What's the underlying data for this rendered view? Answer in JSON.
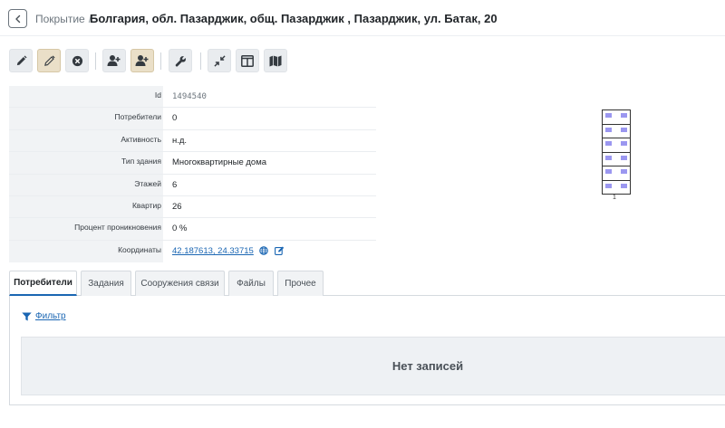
{
  "header": {
    "breadcrumb_parent": "Покрытие",
    "breadcrumb_separator": "/",
    "title": "Болгария, обл. Пазарджик, общ. Пазарджик , Пазарджик, ул. Батак, 20"
  },
  "toolbar": {
    "buttons": [
      {
        "name": "edit-button",
        "icon": "pencil-icon"
      },
      {
        "name": "edit-active-button",
        "icon": "pencil-icon",
        "active": true
      },
      {
        "name": "delete-button",
        "icon": "close-circle-icon"
      },
      {
        "name": "add-user-button",
        "icon": "user-plus-icon"
      },
      {
        "name": "add-user-active-button",
        "icon": "user-plus-icon",
        "active": true
      },
      {
        "name": "tools-button",
        "icon": "wrench-icon"
      },
      {
        "name": "collapse-button",
        "icon": "compress-icon"
      },
      {
        "name": "layout-button",
        "icon": "columns-icon"
      },
      {
        "name": "map-button",
        "icon": "map-icon"
      }
    ]
  },
  "info": {
    "rows": [
      {
        "label": "Id",
        "value": "1494540"
      },
      {
        "label": "Потребители",
        "value": "0"
      },
      {
        "label": "Активность",
        "value": "н.д."
      },
      {
        "label": "Тип здания",
        "value": "Многоквартирные дома"
      },
      {
        "label": "Этажей",
        "value": "6"
      },
      {
        "label": "Квартир",
        "value": "26"
      },
      {
        "label": "Процент проникновения",
        "value": "0 %"
      },
      {
        "label": "Координаты",
        "value": "42.187613, 24.33715"
      }
    ]
  },
  "building": {
    "label": "1",
    "floors": 6,
    "apartment_color": "#9b97f0"
  },
  "tabs": [
    {
      "label": "Потребители",
      "active": true
    },
    {
      "label": "Задания"
    },
    {
      "label": "Сооружения связи"
    },
    {
      "label": "Файлы"
    },
    {
      "label": "Прочее"
    }
  ],
  "content": {
    "filter_label": "Фильтр",
    "empty_text": "Нет записей"
  },
  "colors": {
    "accent": "#1a66b3",
    "active_button": "#eadfc8"
  }
}
